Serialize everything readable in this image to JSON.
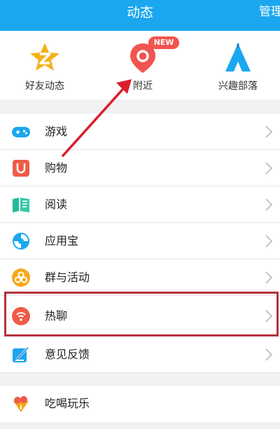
{
  "header": {
    "title": "动态",
    "manage_label": "管理"
  },
  "quick": [
    {
      "label": "好友动态",
      "icon": "star-z-icon"
    },
    {
      "label": "附近",
      "icon": "location-pin-icon",
      "badge": "NEW"
    },
    {
      "label": "兴趣部落",
      "icon": "tent-icon"
    }
  ],
  "menu": [
    {
      "label": "游戏",
      "icon": "gamepad-icon"
    },
    {
      "label": "购物",
      "icon": "shopping-bag-icon"
    },
    {
      "label": "阅读",
      "icon": "book-icon"
    },
    {
      "label": "应用宝",
      "icon": "app-store-icon"
    },
    {
      "label": "群与活动",
      "icon": "group-icon"
    },
    {
      "label": "热聊",
      "icon": "hot-chat-icon"
    },
    {
      "label": "意见反馈",
      "icon": "feedback-icon"
    }
  ],
  "menu2": [
    {
      "label": "吃喝玩乐",
      "icon": "food-icon"
    }
  ],
  "colors": {
    "header": "#1aa7ef",
    "badge": "#f2544f",
    "highlight": "#b5323c",
    "arrow": "#d8202a"
  }
}
